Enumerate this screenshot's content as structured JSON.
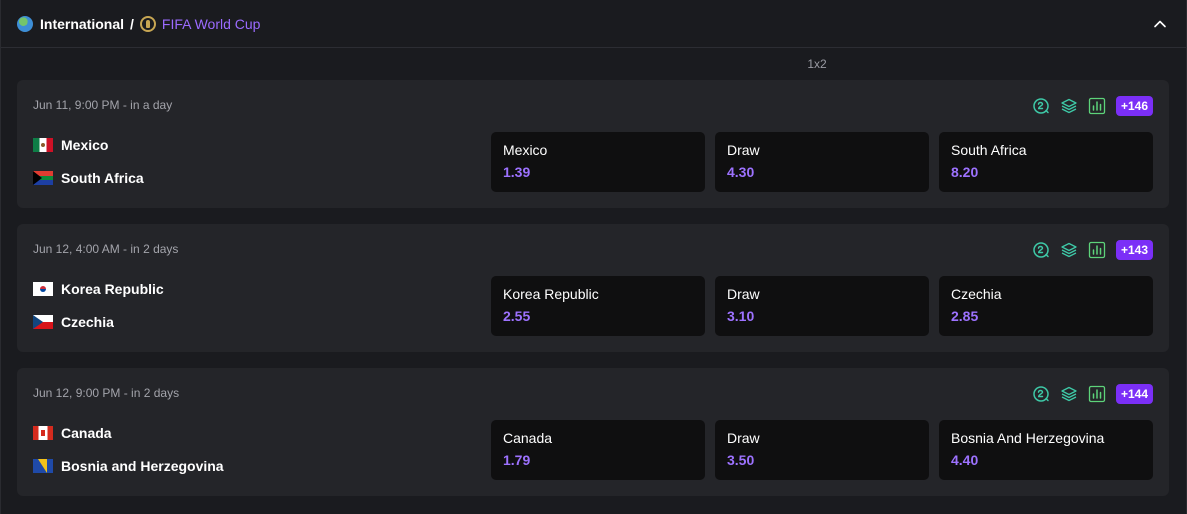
{
  "breadcrumb": {
    "region": "International",
    "separator": "/",
    "league": "FIFA World Cup"
  },
  "market_label": "1x2",
  "matches": [
    {
      "time": "Jun 11, 9:00 PM - in a day",
      "more_markets": "+146",
      "team1": "Mexico",
      "team2": "South Africa",
      "odds": [
        {
          "label": "Mexico",
          "value": "1.39"
        },
        {
          "label": "Draw",
          "value": "4.30"
        },
        {
          "label": "South Africa",
          "value": "8.20"
        }
      ]
    },
    {
      "time": "Jun 12, 4:00 AM - in 2 days",
      "more_markets": "+143",
      "team1": "Korea Republic",
      "team2": "Czechia",
      "odds": [
        {
          "label": "Korea Republic",
          "value": "2.55"
        },
        {
          "label": "Draw",
          "value": "3.10"
        },
        {
          "label": "Czechia",
          "value": "2.85"
        }
      ]
    },
    {
      "time": "Jun 12, 9:00 PM - in 2 days",
      "more_markets": "+144",
      "team1": "Canada",
      "team2": "Bosnia and Herzegovina",
      "odds": [
        {
          "label": "Canada",
          "value": "1.79"
        },
        {
          "label": "Draw",
          "value": "3.50"
        },
        {
          "label": "Bosnia And Herzegovina",
          "value": "4.40"
        }
      ]
    }
  ],
  "colors": {
    "accent": "#7b2ff7",
    "odds_value": "#9d72ff",
    "icon_teal": "#3ec9a7",
    "background": "#1a1b1f",
    "card": "#242529",
    "odds_box": "#0f0f10"
  }
}
